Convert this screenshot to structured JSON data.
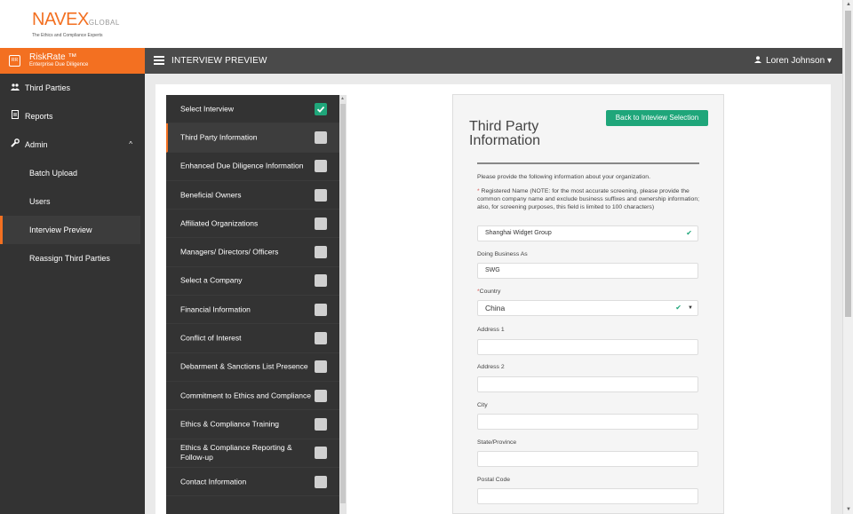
{
  "logo": {
    "main": "NAVEX",
    "global": "GLOBAL",
    "tagline": "The Ethics and Compliance Experts"
  },
  "brand": {
    "icon": "RR",
    "title": "RiskRate ™",
    "subtitle": "Enterprise Due Diligence",
    "color": "#f37021"
  },
  "header": {
    "title": "INTERVIEW PREVIEW",
    "user": "Loren Johnson"
  },
  "sidebar": {
    "items": [
      {
        "label": "Third Parties",
        "icon": "users-icon"
      },
      {
        "label": "Reports",
        "icon": "document-icon"
      },
      {
        "label": "Admin",
        "icon": "wrench-icon"
      }
    ],
    "admin_items": [
      "Batch Upload",
      "Users",
      "Interview Preview",
      "Reassign Third Parties"
    ]
  },
  "steps": [
    {
      "label": "Select Interview",
      "checked": true
    },
    {
      "label": "Third Party Information",
      "checked": false
    },
    {
      "label": "Enhanced Due Diligence Information",
      "checked": false
    },
    {
      "label": "Beneficial Owners",
      "checked": false
    },
    {
      "label": "Affiliated Organizations",
      "checked": false
    },
    {
      "label": "Managers/ Directors/ Officers",
      "checked": false
    },
    {
      "label": "Select a Company",
      "checked": false
    },
    {
      "label": "Financial Information",
      "checked": false
    },
    {
      "label": "Conflict of Interest",
      "checked": false
    },
    {
      "label": "Debarment & Sanctions List Presence",
      "checked": false
    },
    {
      "label": "Commitment to Ethics and Compliance",
      "checked": false
    },
    {
      "label": "Ethics & Compliance Training",
      "checked": false
    },
    {
      "label": "Ethics &  Compliance Reporting & Follow-up",
      "checked": false
    },
    {
      "label": "Contact Information",
      "checked": false
    }
  ],
  "form": {
    "title": "Third Party Information",
    "back_button": "Back to Inteview Selection",
    "intro": "Please provide the following information about your organization.",
    "required_mark": "*",
    "registered_name_label": "Registered Name (NOTE: for the most accurate screening, please provide the common company name and exclude business suffixes and ownership information; also, for screening purposes, this field is limited to 100 characters)",
    "registered_name_value": "Shanghai Widget Group",
    "dba_label": "Doing Business As",
    "dba_value": "SWG",
    "country_label": "Country",
    "country_value": "China",
    "address1_label": "Address 1",
    "address2_label": "Address 2",
    "city_label": "City",
    "state_label": "State/Province",
    "postal_label": "Postal Code"
  },
  "colors": {
    "accent": "#f37021",
    "success": "#1fa67a",
    "sidebar": "#333333"
  }
}
